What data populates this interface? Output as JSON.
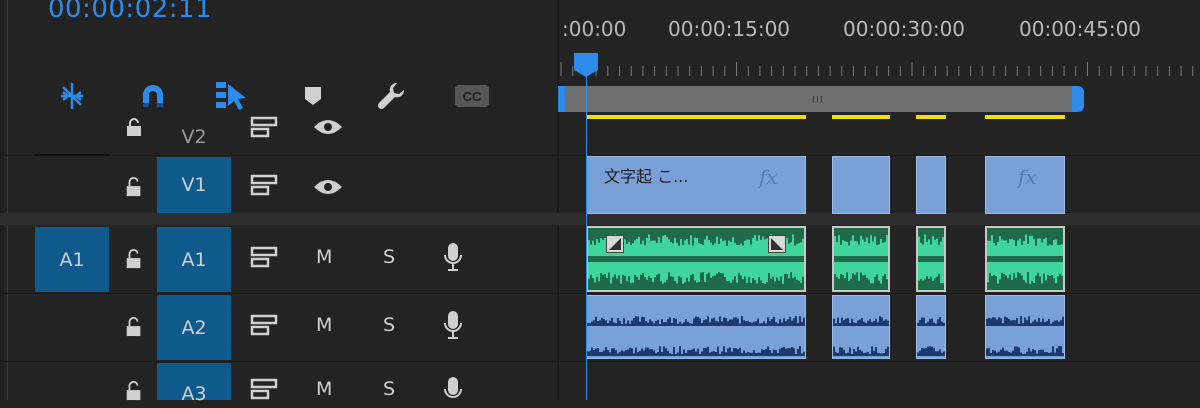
{
  "timecode": "00:00:02:11",
  "ruler": {
    "labels": [
      ":00:00",
      "00:00:15:00",
      "00:00:30:00",
      "00:00:45:00"
    ]
  },
  "toolbar": {
    "icons": [
      "snap-icon",
      "magnet-icon",
      "linked-selection-icon",
      "add-marker-icon",
      "wrench-icon",
      "captions-icon"
    ],
    "captions_label": "CC"
  },
  "tracks": {
    "v2": {
      "label": "V2"
    },
    "v1": {
      "label": "V1"
    },
    "a1_source": {
      "label": "A1"
    },
    "a1": {
      "label": "A1",
      "mute": "M",
      "solo": "S"
    },
    "a2": {
      "label": "A2",
      "mute": "M",
      "solo": "S"
    },
    "a3": {
      "label": "A3",
      "mute": "M",
      "solo": "S"
    }
  },
  "clips": {
    "v1_first_title": "文字起 こ...",
    "fx_label": "fx"
  },
  "colors": {
    "accent": "#2d8ceb",
    "track_target": "#0e5a8c",
    "video_clip": "#7aa0d8",
    "audio_clip_a1": "#3fd69b",
    "render_bar": "#f0e000"
  }
}
